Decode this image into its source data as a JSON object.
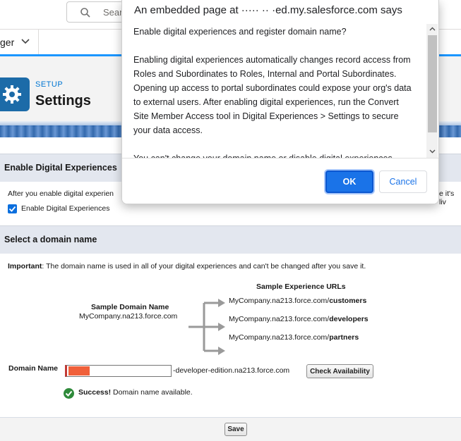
{
  "header": {
    "search_placeholder": "Sear",
    "search_icon": "search-icon"
  },
  "nav": {
    "item_label": "ger",
    "chevron_icon": "chevron-down-icon"
  },
  "banner": {
    "breadcrumb": "SETUP",
    "title": "Settings",
    "icon": "gear-icon"
  },
  "enable_section": {
    "heading": "Enable Digital Experiences",
    "description": "After you enable digital experien",
    "description_tail": "e it's liv",
    "checkbox_label": "Enable Digital Experiences",
    "checkbox_checked": true
  },
  "domain_section": {
    "heading": "Select a domain name",
    "important_label": "Important",
    "important_text": ": The domain name is used in all of your digital experiences and can't be changed after you save it.",
    "sample_urls_title": "Sample Experience URLs",
    "sample_domain_title": "Sample Domain Name",
    "sample_domain_value": "MyCompany.na213.force.com",
    "urls": [
      {
        "prefix": "MyCompany.na213.force.com/",
        "path": "customers"
      },
      {
        "prefix": "MyCompany.na213.force.com/",
        "path": "developers"
      },
      {
        "prefix": "MyCompany.na213.force.com/",
        "path": "partners"
      }
    ],
    "domain_label": "Domain Name",
    "domain_suffix": "-developer-edition.na213.force.com",
    "check_button": "Check Availability",
    "success_label": "Success!",
    "success_text": " Domain name available."
  },
  "footer": {
    "save_button": "Save"
  },
  "dialog": {
    "title": "An embedded page at ····· ·· ·ed.my.salesforce.com says",
    "question": "Enable digital experiences and register domain name?",
    "paragraph1": "Enabling digital experiences automatically changes record access from Roles and Subordinates to Roles, Internal and Portal Subordinates. Opening up access to portal subordinates could expose your org's data to external users. After enabling digital experiences, run the Convert Site Member Access tool in Digital Experiences > Settings to secure your data access.",
    "paragraph2": "You can't change your domain name or disable digital experiences",
    "ok_button": "OK",
    "cancel_button": "Cancel"
  },
  "colors": {
    "accent": "#0176d3",
    "ok_button": "#1a73e8",
    "success": "#2e8a3a",
    "section_header": "#e3e7ef"
  }
}
